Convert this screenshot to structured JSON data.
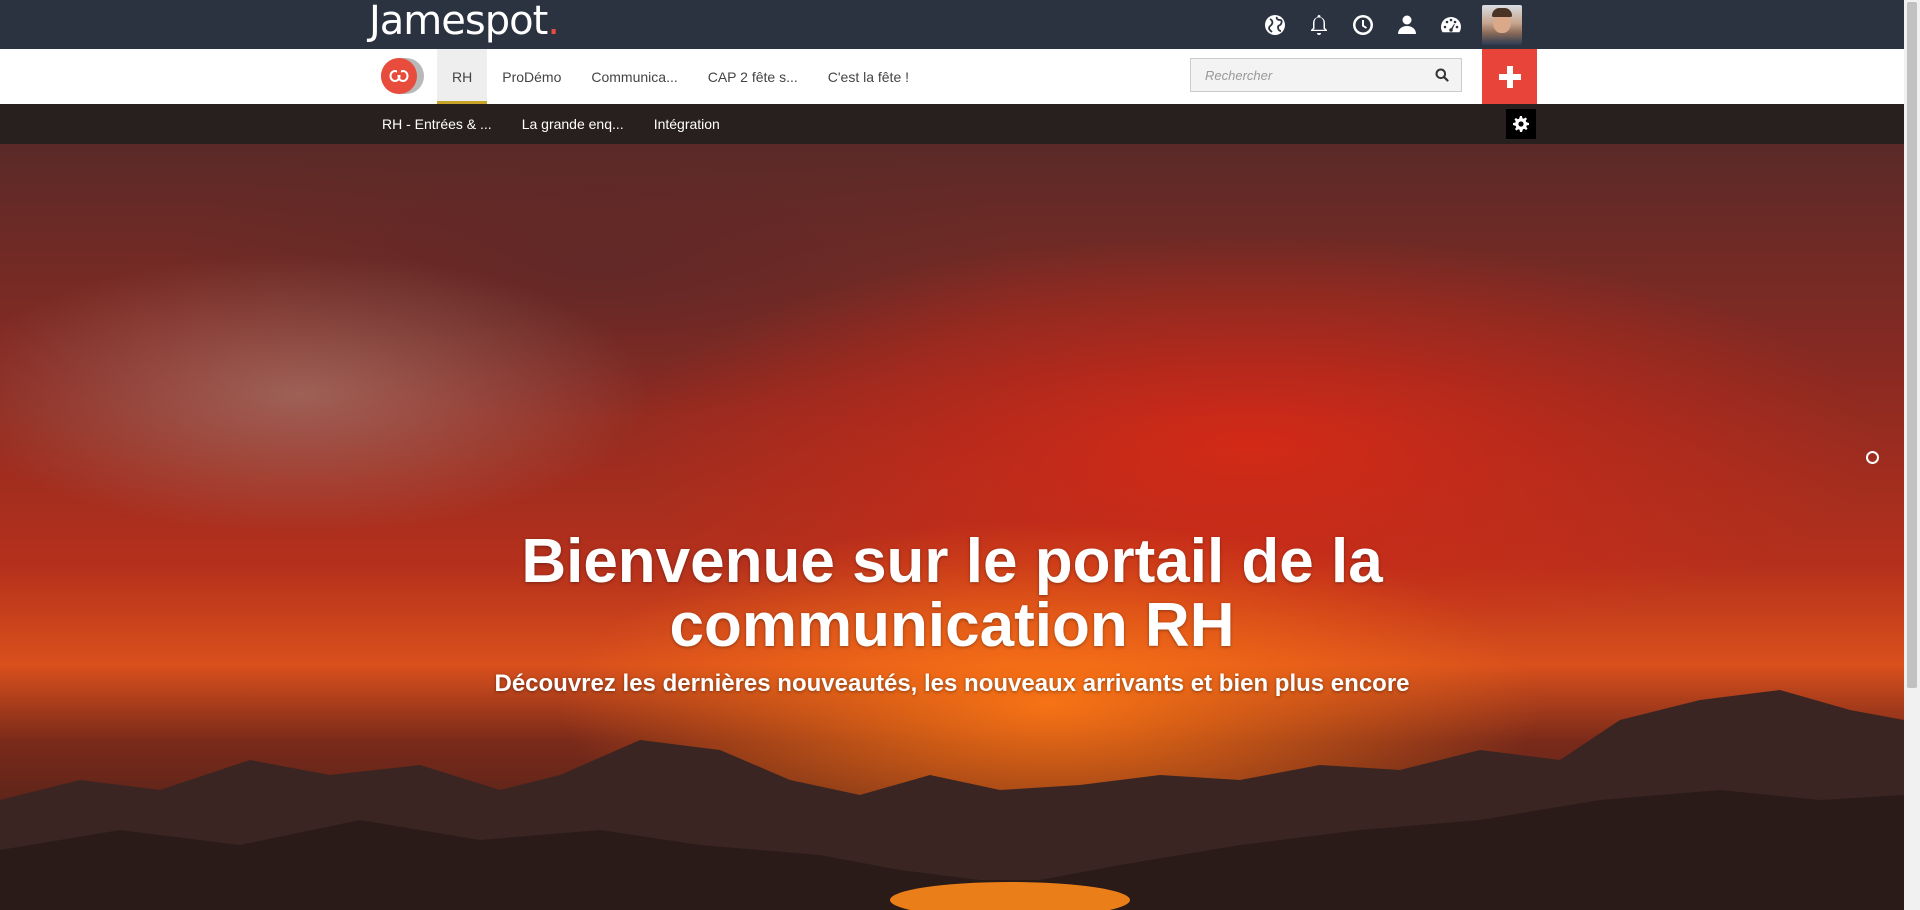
{
  "app": {
    "logo_text": "Jamespot",
    "logo_dot": "."
  },
  "topbar": {
    "icons": [
      "globe-icon",
      "bell-icon",
      "clock-icon",
      "user-icon",
      "dashboard-icon"
    ],
    "avatar_alt": "avatar"
  },
  "nav": {
    "tabs": [
      {
        "label": "RH",
        "active": true
      },
      {
        "label": "ProDémo"
      },
      {
        "label": "Communica..."
      },
      {
        "label": "CAP 2 fête s..."
      },
      {
        "label": "C'est la fête !"
      }
    ],
    "search_placeholder": "Rechercher"
  },
  "subnav": {
    "items": [
      {
        "label": "RH - Entrées & ..."
      },
      {
        "label": "La grande enq..."
      },
      {
        "label": "Intégration"
      }
    ]
  },
  "hero": {
    "title_line1": "Bienvenue sur le portail de la",
    "title_line2": "communication RH",
    "subtitle": "Découvrez les dernières nouveautés, les nouveaux arrivants et bien plus encore"
  },
  "colors": {
    "topbar_bg": "#2b3240",
    "accent_red": "#e84c3d",
    "active_tab_underline": "#c8a42b",
    "subnav_bg": "#28201e"
  }
}
